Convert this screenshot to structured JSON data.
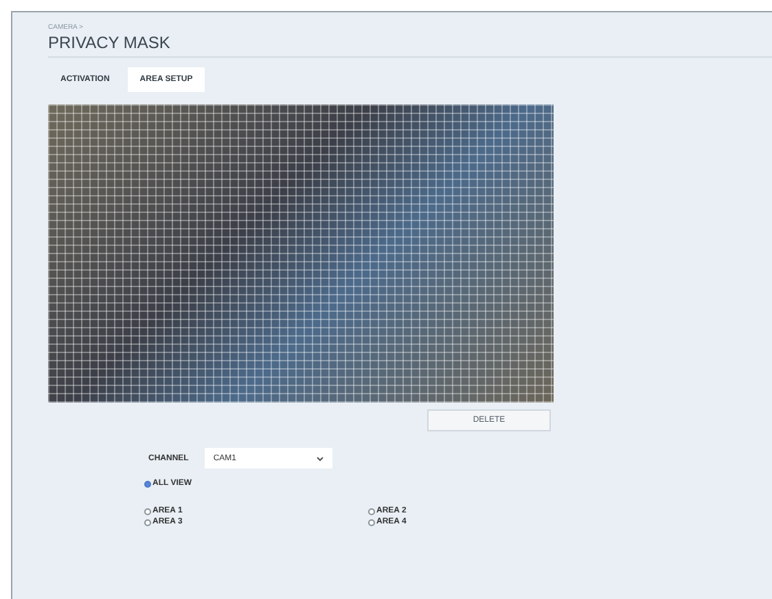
{
  "breadcrumb": "CAMERA >",
  "title": "PRIVACY MASK",
  "tabs": [
    {
      "label": "ACTIVATION",
      "selected": false
    },
    {
      "label": "AREA SETUP",
      "selected": true
    }
  ],
  "delete_button": "DELETE",
  "channel": {
    "label": "CHANNEL",
    "value": "CAM1"
  },
  "view_options": [
    {
      "label": "ALL VIEW",
      "selected": true
    }
  ],
  "areas": [
    {
      "label": "AREA 1",
      "selected": false
    },
    {
      "label": "AREA 2",
      "selected": false
    },
    {
      "label": "AREA 3",
      "selected": false
    },
    {
      "label": "AREA 4",
      "selected": false
    }
  ]
}
